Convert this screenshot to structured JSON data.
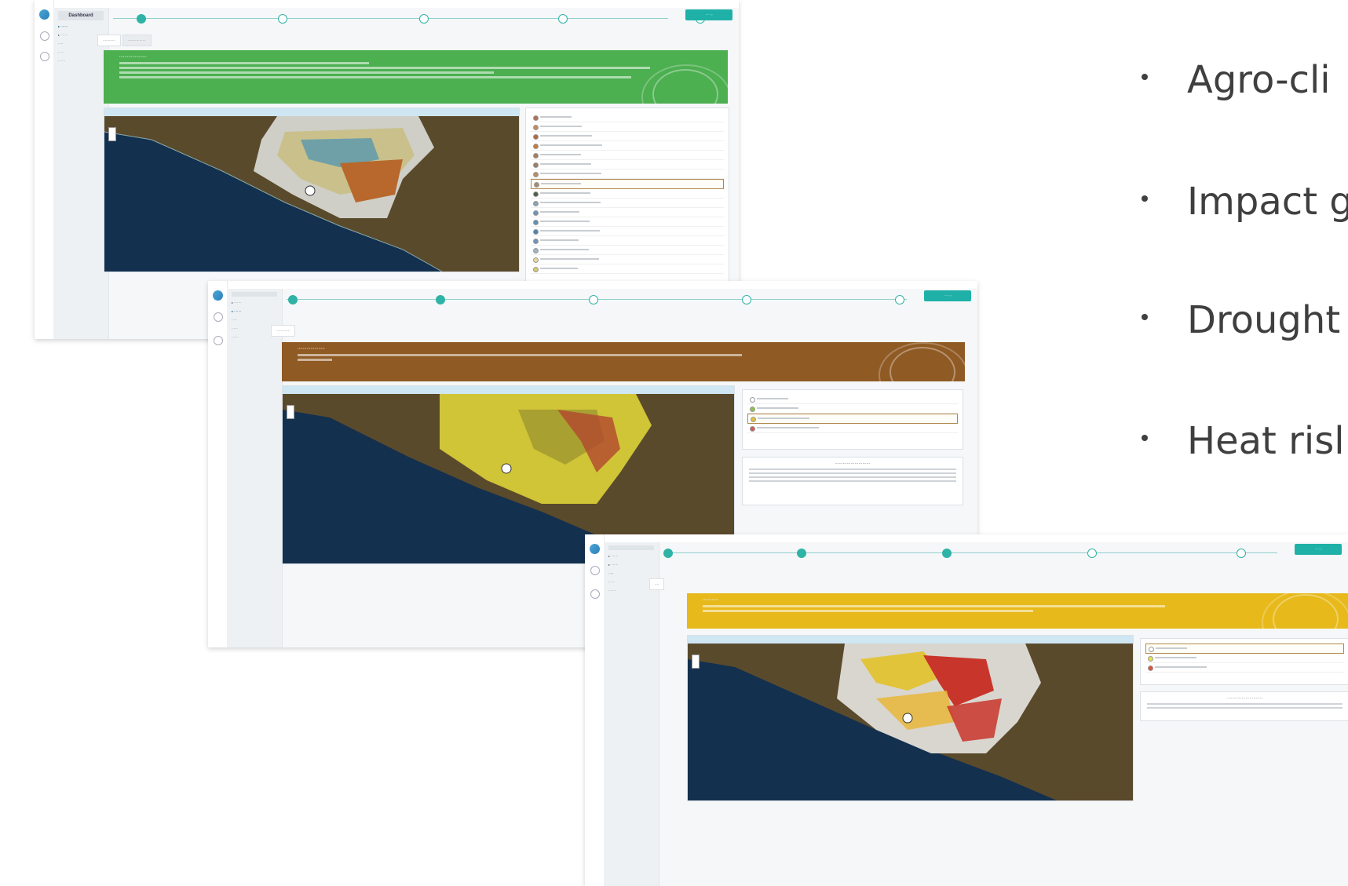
{
  "slide": {
    "bullets": [
      {
        "text": "Agro-cli"
      },
      {
        "text": "Impact g"
      },
      {
        "text": "Drought"
      },
      {
        "text": "Heat risl"
      }
    ]
  },
  "screens": [
    {
      "sidebar_title": "Dashboard",
      "map_title": "",
      "legend_title": "",
      "banner_color": "#4caf50",
      "legend_colors": [
        "#b0705a",
        "#c68a5c",
        "#b0693e",
        "#c77a3a",
        "#a8795e",
        "#9b7b62",
        "#b58d6b",
        "#a88b6d",
        "#4a5d48",
        "#8aa3b0",
        "#6f95b5",
        "#5f8fb2",
        "#4c84b1",
        "#6d93b6",
        "#9fb3c2",
        "#e6d99d",
        "#d8c96b"
      ],
      "legend_selected_index": 7
    },
    {
      "sidebar_title": "",
      "map_title": "",
      "legend_title": "",
      "banner_color": "#8f5a24",
      "legend_colors": [
        "#ffffff",
        "#8bc34a",
        "#e0c23a",
        "#d05a5a"
      ],
      "legend_selected_index": 2
    },
    {
      "sidebar_title": "",
      "map_title": "",
      "legend_title": "",
      "banner_color": "#e7b91a",
      "legend_colors": [
        "#ffffff",
        "#e8e24a",
        "#e0523a"
      ],
      "legend_selected_index": 0
    }
  ]
}
